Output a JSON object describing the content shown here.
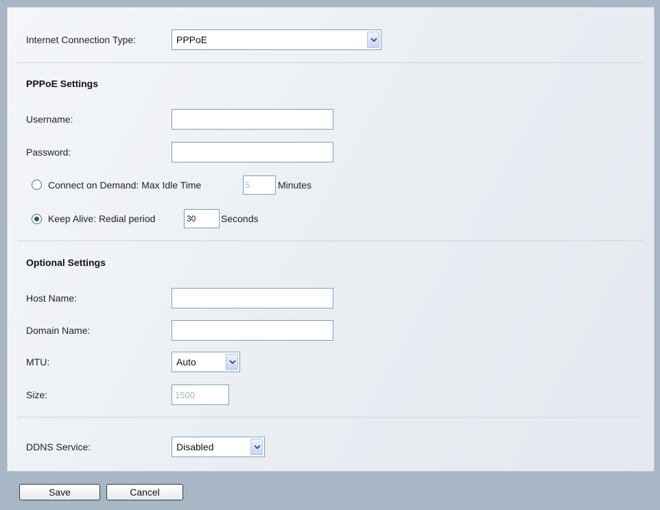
{
  "connection": {
    "label": "Internet Connection Type:",
    "selected": "PPPoE"
  },
  "pppoe": {
    "heading": "PPPoE Settings",
    "username_label": "Username:",
    "username_value": "",
    "password_label": "Password:",
    "password_value": "",
    "connect_on_demand_label": "Connect on Demand: Max Idle Time",
    "connect_on_demand_selected": false,
    "max_idle_time_value": "5",
    "minutes_label": "Minutes",
    "keep_alive_label": "Keep Alive: Redial period",
    "keep_alive_selected": true,
    "redial_period_value": "30",
    "seconds_label": "Seconds"
  },
  "optional": {
    "heading": "Optional Settings",
    "host_name_label": "Host Name:",
    "host_name_value": "",
    "domain_name_label": "Domain Name:",
    "domain_name_value": "",
    "mtu_label": "MTU:",
    "mtu_selected": "Auto",
    "size_label": "Size:",
    "size_value": "1500"
  },
  "ddns": {
    "label": "DDNS Service:",
    "selected": "Disabled"
  },
  "buttons": {
    "save": "Save",
    "cancel": "Cancel"
  },
  "icons": {
    "dropdown": "chevron-down-icon",
    "radio": "radio-button-icon"
  },
  "colors": {
    "page_background": "#a9b6c6",
    "panel_background": "#eef1f5",
    "input_border": "#7f9db9",
    "radio_selected": "#1d6a38"
  }
}
